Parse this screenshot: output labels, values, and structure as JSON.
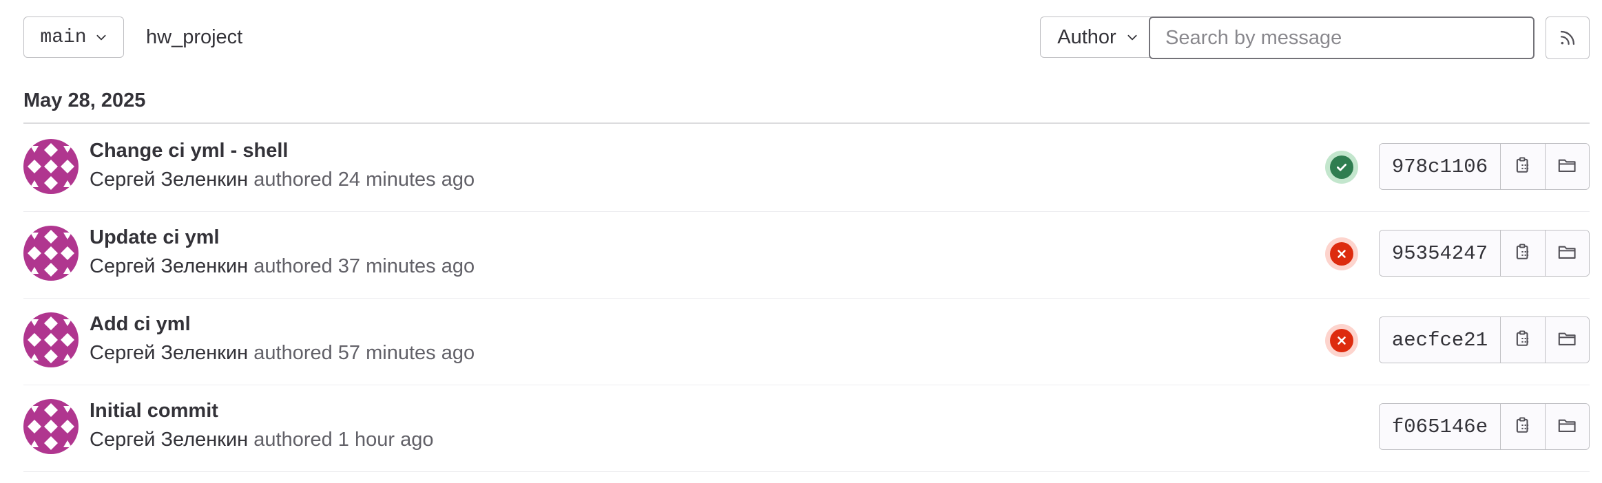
{
  "toolbar": {
    "branch": "main",
    "project_path": "hw_project",
    "author_filter_label": "Author",
    "search_placeholder": "Search by message"
  },
  "date_group": "May 28, 2025",
  "commits": [
    {
      "title": "Change ci yml - shell",
      "author": "Сергей Зеленкин",
      "authored_text": "authored 24 minutes ago",
      "status": "success",
      "sha": "978c1106"
    },
    {
      "title": "Update ci yml",
      "author": "Сергей Зеленкин",
      "authored_text": "authored 37 minutes ago",
      "status": "failed",
      "sha": "95354247"
    },
    {
      "title": "Add ci yml",
      "author": "Сергей Зеленкин",
      "authored_text": "authored 57 minutes ago",
      "status": "failed",
      "sha": "aecfce21"
    },
    {
      "title": "Initial commit",
      "author": "Сергей Зеленкин",
      "authored_text": "authored 1 hour ago",
      "status": "none",
      "sha": "f065146e"
    }
  ],
  "colors": {
    "avatar": "#b0368f",
    "success": "#2f7d50",
    "failed": "#dd2b0e"
  },
  "icons": [
    "chevron-down-icon",
    "rss-icon",
    "avatar-identicon",
    "status-success-icon",
    "status-failed-icon",
    "copy-sha-icon",
    "browse-files-icon"
  ]
}
